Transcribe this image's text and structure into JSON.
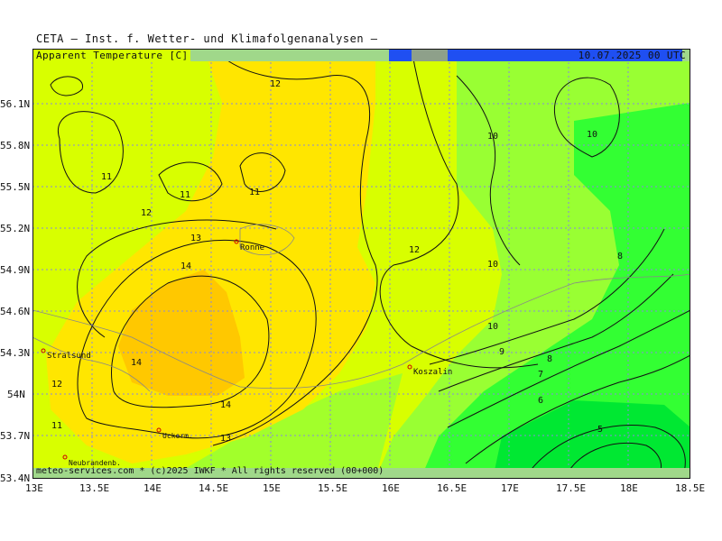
{
  "title": "CETA — Inst. f. Wetter- und Klimafolgenanalysen —",
  "product": "Apparent Temperature [C]",
  "valid_time": "10.07.2025 00 UTC",
  "footer": "meteo-services.com * (c)2025 IWKF * All rights reserved (00+000)",
  "lat_labels": [
    "56.1N",
    "55.8N",
    "55.5N",
    "55.2N",
    "54.9N",
    "54.6N",
    "54.3N",
    "54N",
    "53.7N",
    "53.4N"
  ],
  "lon_labels": [
    "13E",
    "13.5E",
    "14E",
    "14.5E",
    "15E",
    "15.5E",
    "16E",
    "16.5E",
    "17E",
    "17.5E",
    "18E",
    "18.5E"
  ],
  "cities": [
    "Ronne",
    "Stralsund",
    "Koszalin",
    "Uckerm.",
    "Neubrandenb."
  ],
  "contour_labels": [
    "12",
    "11",
    "11",
    "11",
    "12",
    "13",
    "14",
    "14",
    "14",
    "13",
    "12",
    "11",
    "12",
    "10",
    "10",
    "10",
    "10",
    "8",
    "9",
    "8",
    "7",
    "6",
    "5"
  ],
  "colors": {
    "lightgreen": "#d8ff00",
    "yellow": "#ffe600",
    "orange": "#ffc800",
    "green1": "#99ff33",
    "green2": "#33ff33",
    "green3": "#00e832",
    "grid": "#8888dd"
  }
}
